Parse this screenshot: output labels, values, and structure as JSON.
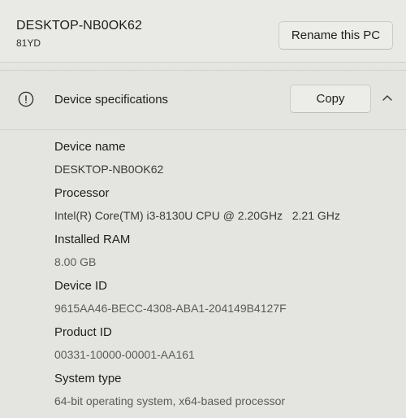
{
  "pc": {
    "name": "DESKTOP-NB0OK62",
    "model": "81YD",
    "rename_label": "Rename this PC"
  },
  "specs": {
    "title": "Device specifications",
    "copy_label": "Copy",
    "items": [
      {
        "label": "Device name",
        "value": "DESKTOP-NB0OK62"
      },
      {
        "label": "Processor",
        "value": "Intel(R) Core(TM) i3-8130U CPU @ 2.20GHz   2.21 GHz"
      },
      {
        "label": "Installed RAM",
        "value": "8.00 GB"
      },
      {
        "label": "Device ID",
        "value": "9615AA46-BECC-4308-ABA1-204149B4127F"
      },
      {
        "label": "Product ID",
        "value": "00331-10000-00001-AA161"
      },
      {
        "label": "System type",
        "value": "64-bit operating system, x64-based processor"
      }
    ]
  },
  "icons": {
    "info": "info-icon",
    "collapse": "chevron-up-icon"
  }
}
